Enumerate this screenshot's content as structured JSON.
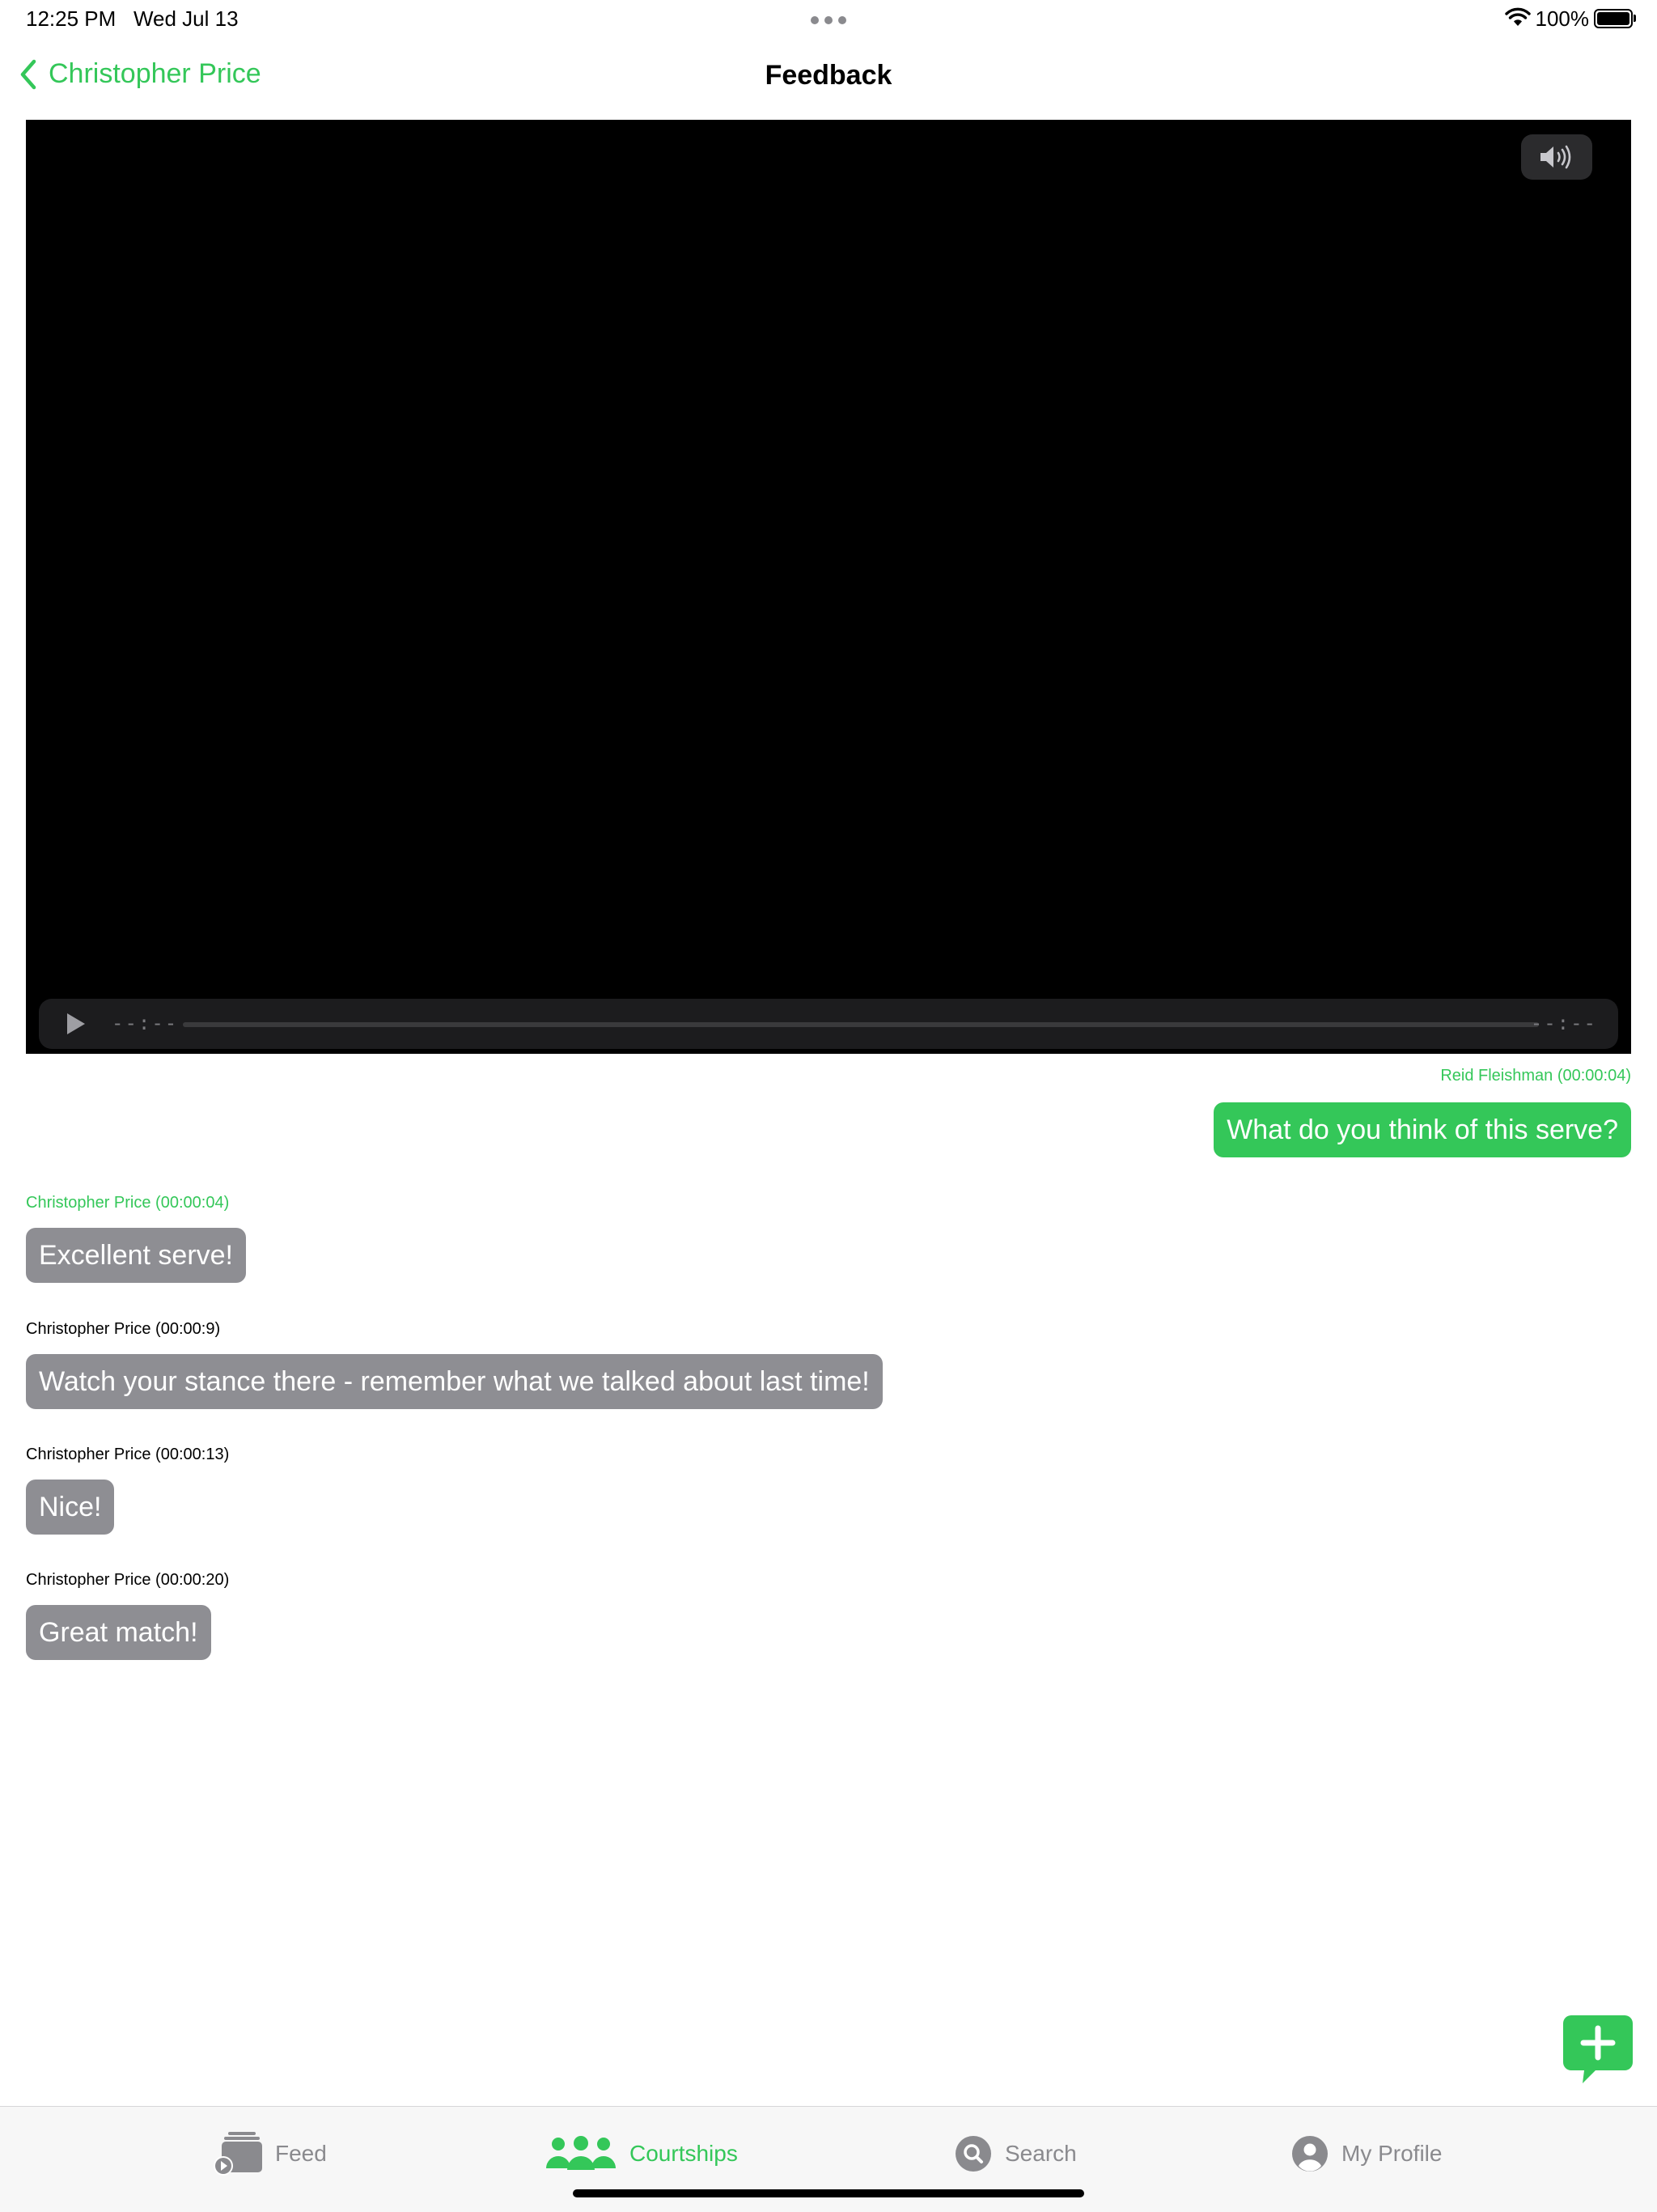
{
  "status_bar": {
    "time": "12:25 PM",
    "date": "Wed Jul 13",
    "battery_text": "100%",
    "battery_level": 1.0
  },
  "nav": {
    "back_label": "Christopher Price",
    "title": "Feedback"
  },
  "video": {
    "elapsed": "--:--",
    "remaining": "--:--"
  },
  "comments": [
    {
      "author_line": "Reid Fleishman (00:00:04)",
      "text": "What do you think of this serve?"
    },
    {
      "author_line": "Christopher Price (00:00:04)",
      "text": "Excellent serve!"
    },
    {
      "author_line": "Christopher Price (00:00:9)",
      "text": "Watch your stance there - remember what we talked about last time!"
    },
    {
      "author_line": "Christopher Price (00:00:13)",
      "text": "Nice!"
    },
    {
      "author_line": "Christopher Price (00:00:20)",
      "text": "Great match!"
    }
  ],
  "tabs": [
    {
      "label": "Feed",
      "icon": "feed-icon"
    },
    {
      "label": "Courtships",
      "icon": "people-icon",
      "active": true
    },
    {
      "label": "Search",
      "icon": "search-icon"
    },
    {
      "label": "My Profile",
      "icon": "profile-icon"
    }
  ],
  "colors": {
    "accent": "#34c759",
    "bubble_gray": "#8e8e93",
    "tab_inactive": "#8a8a8e"
  }
}
